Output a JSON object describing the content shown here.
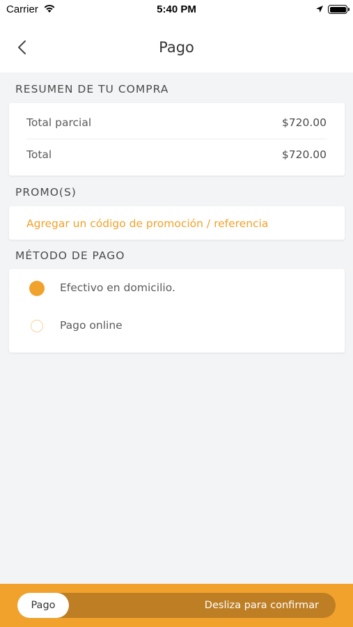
{
  "status_bar": {
    "carrier": "Carrier",
    "time": "5:40 PM",
    "icons": [
      "wifi-icon",
      "location-icon",
      "battery-icon"
    ]
  },
  "nav": {
    "back_icon": "chevron-left-icon",
    "title": "Pago"
  },
  "summary": {
    "header": "RESUMEN DE TU COMPRA",
    "rows": [
      {
        "label": "Total parcial",
        "value": "$720.00"
      },
      {
        "label": "Total",
        "value": "$720.00"
      }
    ]
  },
  "promo": {
    "header": "PROMO(S)",
    "link": "Agregar un código de promoción / referencia"
  },
  "payment": {
    "header": "MÉTODO DE PAGO",
    "options": [
      {
        "label": "Efectivo en domicilio.",
        "selected": true
      },
      {
        "label": "Pago online",
        "selected": false
      }
    ]
  },
  "footer": {
    "thumb_label": "Pago",
    "hint": "Desliza para confirmar"
  },
  "colors": {
    "accent": "#f0a22c",
    "slider_track": "#bd7e24",
    "background": "#f3f4f6"
  }
}
